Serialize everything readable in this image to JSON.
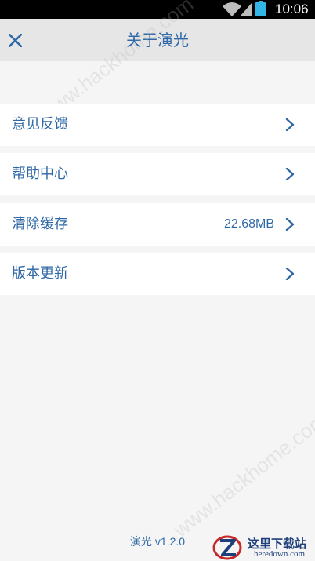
{
  "status_bar": {
    "time": "10:06",
    "icons": [
      "wifi-icon",
      "signal-icon",
      "battery-icon"
    ]
  },
  "header": {
    "close_icon": "close-icon",
    "title": "关于演光"
  },
  "menu": {
    "items": [
      {
        "label": "意见反馈",
        "value": "",
        "icon": "chevron-right-icon"
      },
      {
        "label": "帮助中心",
        "value": "",
        "icon": "chevron-right-icon"
      },
      {
        "label": "清除缓存",
        "value": "22.68MB",
        "icon": "chevron-right-icon"
      },
      {
        "label": "版本更新",
        "value": "",
        "icon": "chevron-right-icon"
      }
    ]
  },
  "footer": {
    "app_name": "演光",
    "version": "v1.2.0"
  },
  "watermarks": {
    "top": "www.hackhome.com",
    "bottom": "www.hackhome.com"
  },
  "corner_logo": {
    "name_cn": "这里下载站",
    "name_en": "heredown.com"
  },
  "colors": {
    "accent": "#2f68a6",
    "header_bg": "#e6e6e6",
    "page_bg": "#f5f5f5",
    "row_bg": "#ffffff",
    "status_bar_bg": "#000000",
    "battery": "#33b5e5"
  }
}
